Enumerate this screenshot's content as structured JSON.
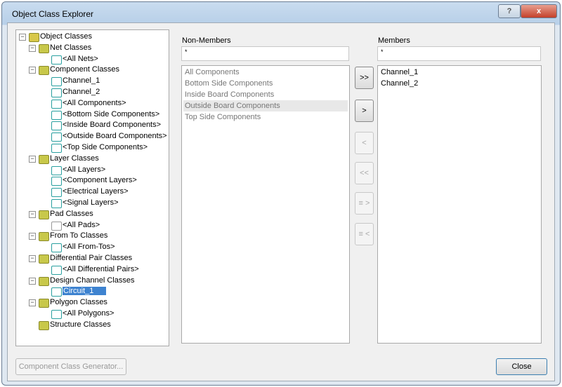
{
  "window": {
    "title": "Object Class Explorer",
    "help_label": "?",
    "close_label": "x"
  },
  "tree": [
    {
      "label": "Object Classes",
      "level": 0,
      "exp": true,
      "icon": "folder-image-icon",
      "color": "#d8c84a"
    },
    {
      "label": "Net Classes",
      "level": 1,
      "exp": true,
      "icon": "folder-net-icon",
      "color": "#c8c84a"
    },
    {
      "label": "<All Nets>",
      "level": 2,
      "icon": "net-icon",
      "color": "#2aa0a0"
    },
    {
      "label": "Component Classes",
      "level": 1,
      "exp": true,
      "icon": "folder-component-icon",
      "color": "#c8c84a"
    },
    {
      "label": "Channel_1",
      "level": 2,
      "icon": "component-icon",
      "color": "#2aa0a0"
    },
    {
      "label": "Channel_2",
      "level": 2,
      "icon": "component-icon",
      "color": "#2aa0a0"
    },
    {
      "label": "<All Components>",
      "level": 2,
      "icon": "component-icon",
      "color": "#2aa0a0"
    },
    {
      "label": "<Bottom Side Components>",
      "level": 2,
      "icon": "component-icon",
      "color": "#2aa0a0"
    },
    {
      "label": "<Inside Board Components>",
      "level": 2,
      "icon": "component-icon",
      "color": "#2aa0a0"
    },
    {
      "label": "<Outside Board Components>",
      "level": 2,
      "icon": "component-icon",
      "color": "#2aa0a0"
    },
    {
      "label": "<Top Side Components>",
      "level": 2,
      "icon": "component-icon",
      "color": "#2aa0a0"
    },
    {
      "label": "Layer Classes",
      "level": 1,
      "exp": true,
      "icon": "folder-layer-icon",
      "color": "#c8c84a"
    },
    {
      "label": "<All Layers>",
      "level": 2,
      "icon": "layer-icon",
      "color": "#2aa0a0"
    },
    {
      "label": "<Component Layers>",
      "level": 2,
      "icon": "layer-icon",
      "color": "#2aa0a0"
    },
    {
      "label": "<Electrical Layers>",
      "level": 2,
      "icon": "layer-icon",
      "color": "#2aa0a0"
    },
    {
      "label": "<Signal Layers>",
      "level": 2,
      "icon": "layer-icon",
      "color": "#2aa0a0"
    },
    {
      "label": "Pad Classes",
      "level": 1,
      "exp": true,
      "icon": "folder-pad-icon",
      "color": "#c8c84a"
    },
    {
      "label": "<All Pads>",
      "level": 2,
      "icon": "pad-icon",
      "color": "#999999"
    },
    {
      "label": "From To Classes",
      "level": 1,
      "exp": true,
      "icon": "folder-fromto-icon",
      "color": "#c8c84a"
    },
    {
      "label": "<All From-Tos>",
      "level": 2,
      "icon": "fromto-icon",
      "color": "#2aa0a0"
    },
    {
      "label": "Differential Pair Classes",
      "level": 1,
      "exp": true,
      "icon": "folder-diffpair-icon",
      "color": "#c8c84a"
    },
    {
      "label": "<All Differential Pairs>",
      "level": 2,
      "icon": "diffpair-icon",
      "color": "#2aa0a0"
    },
    {
      "label": "Design Channel Classes",
      "level": 1,
      "exp": true,
      "icon": "folder-channel-icon",
      "color": "#c8c84a"
    },
    {
      "label": "Circuit_1",
      "level": 2,
      "icon": "channel-icon",
      "color": "#2aa0a0",
      "selected": true
    },
    {
      "label": "Polygon Classes",
      "level": 1,
      "exp": true,
      "icon": "folder-polygon-icon",
      "color": "#c8c84a"
    },
    {
      "label": "<All Polygons>",
      "level": 2,
      "icon": "polygon-icon",
      "color": "#2aa0a0"
    },
    {
      "label": "Structure Classes",
      "level": 1,
      "icon": "structure-icon",
      "color": "#c8c84a"
    }
  ],
  "non_members": {
    "label": "Non-Members",
    "filter": "*",
    "items": [
      "All Components",
      "Bottom Side Components",
      "Inside Board Components",
      "Outside Board Components",
      "Top Side Components"
    ],
    "highlighted": 3
  },
  "members": {
    "label": "Members",
    "filter": "*",
    "items": [
      "Channel_1",
      "Channel_2"
    ]
  },
  "move_buttons": [
    {
      "label": ">>",
      "name": "add-all-button",
      "enabled": true
    },
    {
      "label": ">",
      "name": "add-button",
      "enabled": true
    },
    {
      "label": "<",
      "name": "remove-button",
      "enabled": false
    },
    {
      "label": "<<",
      "name": "remove-all-button",
      "enabled": false
    },
    {
      "label": "≡ >",
      "name": "add-class-button",
      "enabled": false
    },
    {
      "label": "≡ <",
      "name": "remove-class-button",
      "enabled": false
    }
  ],
  "footer": {
    "generator_label": "Component Class Generator...",
    "close_label": "Close"
  }
}
